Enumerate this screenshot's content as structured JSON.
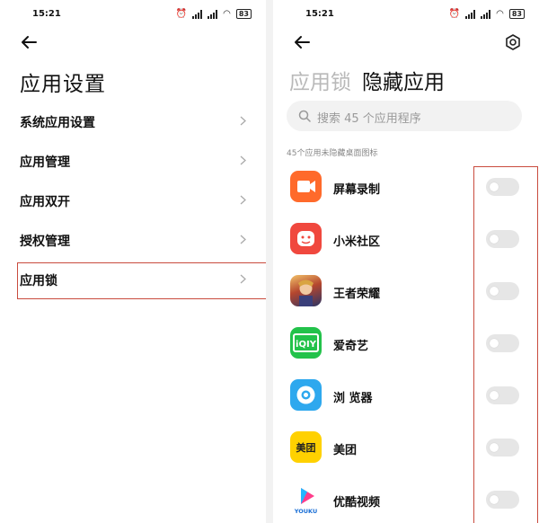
{
  "left_screen": {
    "status": {
      "time": "15:21",
      "battery": "83"
    },
    "title": "应用设置",
    "menu_items": [
      {
        "label": "系统应用设置"
      },
      {
        "label": "应用管理"
      },
      {
        "label": "应用双开"
      },
      {
        "label": "授权管理"
      },
      {
        "label": "应用锁",
        "highlighted": true
      }
    ]
  },
  "right_screen": {
    "status": {
      "time": "15:21",
      "battery": "83"
    },
    "tabs": [
      {
        "label": "应用锁",
        "active": false
      },
      {
        "label": "隐藏应用",
        "active": true
      }
    ],
    "search": {
      "placeholder": "搜索 45 个应用程序"
    },
    "hint": "45个应用未隐藏桌面图标",
    "apps": [
      {
        "name": "屏幕录制",
        "icon": "screen-recorder-icon",
        "color": "#ff6a2b",
        "hidden": false
      },
      {
        "name": "小米社区",
        "icon": "mi-community-icon",
        "color": "#f0483e",
        "hidden": false
      },
      {
        "name": "王者荣耀",
        "icon": "honor-of-kings-icon",
        "color": "#3a4c8c",
        "hidden": false
      },
      {
        "name": "爱奇艺",
        "icon": "iqiyi-icon",
        "color": "#22c24a",
        "icon_text": "iQIY",
        "hidden": false
      },
      {
        "name": "浏 览器",
        "icon": "browser-icon",
        "color": "#2ea8ee",
        "hidden": false
      },
      {
        "name": "美团",
        "icon": "meituan-icon",
        "color": "#ffd100",
        "icon_text": "美团",
        "hidden": false
      },
      {
        "name": "优酷视频",
        "icon": "youku-icon",
        "color": "#ffffff",
        "icon_text": "YOUKU",
        "hidden": false
      }
    ]
  },
  "colors": {
    "highlight_border": "#c94b3e",
    "toggle_off": "#e6e6e6"
  }
}
